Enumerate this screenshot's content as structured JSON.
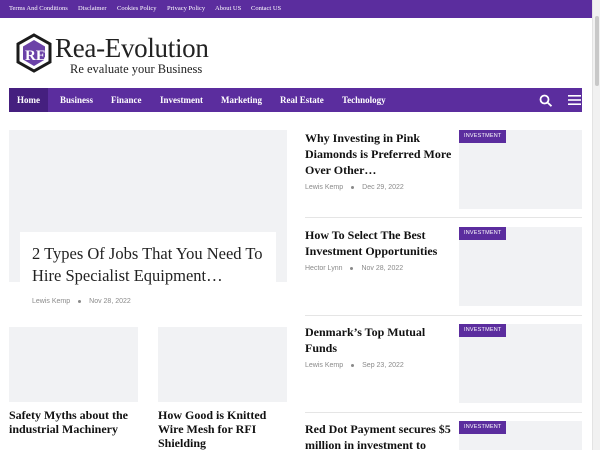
{
  "topbar": {
    "links": [
      "Terms And Conditions",
      "Disclaimer",
      "Cookies Policy",
      "Privacy Policy",
      "About US",
      "Contact US"
    ]
  },
  "brand": {
    "title": "Rea-Evolution",
    "tagline": "Re evaluate your Business",
    "logo_letters": "RE"
  },
  "nav": {
    "items": [
      "Home",
      "Business",
      "Finance",
      "Investment",
      "Marketing",
      "Real Estate",
      "Technology"
    ],
    "active": "Home",
    "search_icon": "search-icon",
    "menu_icon": "hamburger-menu-icon"
  },
  "hero": {
    "title": "2 Types Of Jobs That You Need To Hire Specialist Equipment…",
    "author": "Lewis Kemp",
    "date": "Nov 28, 2022"
  },
  "cards": [
    {
      "title": "Safety Myths about the industrial Machinery"
    },
    {
      "title": "How Good is Knitted Wire Mesh for RFI Shielding"
    }
  ],
  "list": [
    {
      "title": "Why Investing in Pink Diamonds is Preferred More Over Other…",
      "author": "Lewis Kemp",
      "date": "Dec 29, 2022",
      "badge": "INVESTMENT"
    },
    {
      "title": "How To Select The Best Investment Opportunities",
      "author": "Hector Lynn",
      "date": "Nov 28, 2022",
      "badge": "INVESTMENT"
    },
    {
      "title": "Denmark’s Top Mutual Funds",
      "author": "Lewis Kemp",
      "date": "Sep 23, 2022",
      "badge": "INVESTMENT"
    },
    {
      "title": "Red Dot Payment secures $5 million in investment to",
      "badge": "INVESTMENT"
    }
  ],
  "colors": {
    "accent": "#5b2d9e",
    "accent_dark": "#451f7f",
    "placeholder": "#f1f2f4"
  }
}
